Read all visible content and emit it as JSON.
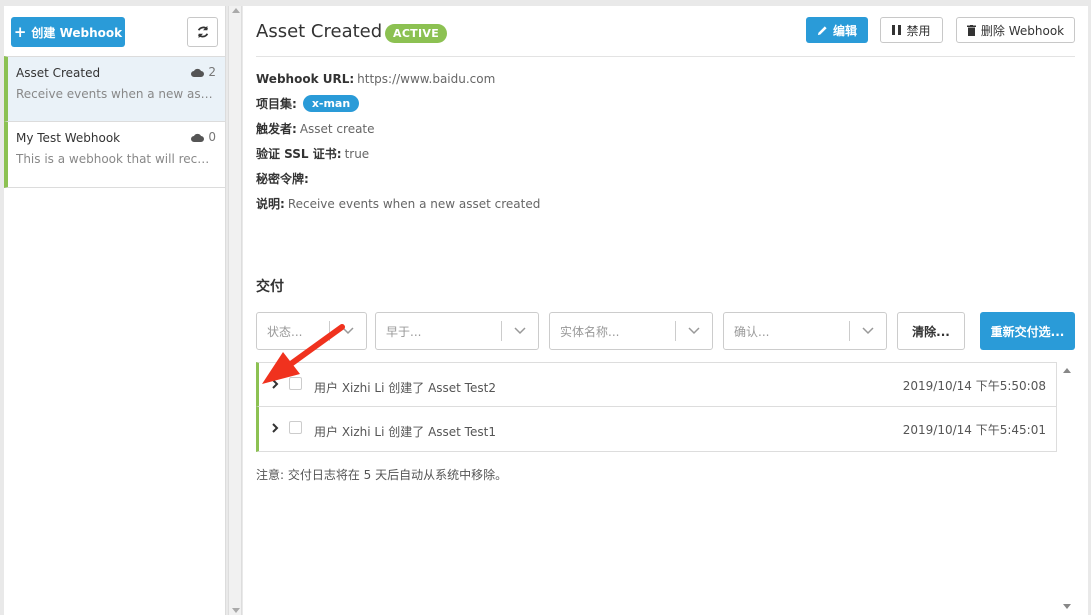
{
  "sidebar": {
    "create_label": "创建 Webhook",
    "items": [
      {
        "name": "Asset Created",
        "count": "2",
        "desc": "Receive events when a new asset created",
        "selected": true
      },
      {
        "name": "My Test Webhook",
        "count": "0",
        "desc": "This is a webhook that will receive events",
        "selected": false
      }
    ]
  },
  "header": {
    "title": "Asset Created",
    "status": "ACTIVE",
    "edit_label": "编辑",
    "disable_label": "禁用",
    "delete_label": "删除 Webhook"
  },
  "details": {
    "url_key": "Webhook URL:",
    "url_val": "https://www.baidu.com",
    "project_key": "项目集:",
    "project_tag": "x-man",
    "trigger_key": "触发者:",
    "trigger_val": "Asset create",
    "ssl_key": "验证 SSL 证书:",
    "ssl_val": "true",
    "secret_key": "秘密令牌:",
    "desc_key": "说明:",
    "desc_val": "Receive events when a new asset created"
  },
  "deliveries": {
    "title": "交付",
    "filters": {
      "status": "状态...",
      "before": "早于...",
      "entity": "实体名称...",
      "confirm": "确认..."
    },
    "clear_label": "清除...",
    "redeliver_label": "重新交付选...",
    "rows": [
      {
        "msg": "用户 Xizhi Li 创建了 Asset Test2",
        "time": "2019/10/14 下午5:50:08"
      },
      {
        "msg": "用户 Xizhi Li 创建了 Asset Test1",
        "time": "2019/10/14 下午5:45:01"
      }
    ],
    "note": "注意: 交付日志将在 5 天后自动从系统中移除。"
  },
  "colors": {
    "accent": "#2a9bd8",
    "active_green": "#8cc152",
    "annotation_red": "#f0321e"
  }
}
